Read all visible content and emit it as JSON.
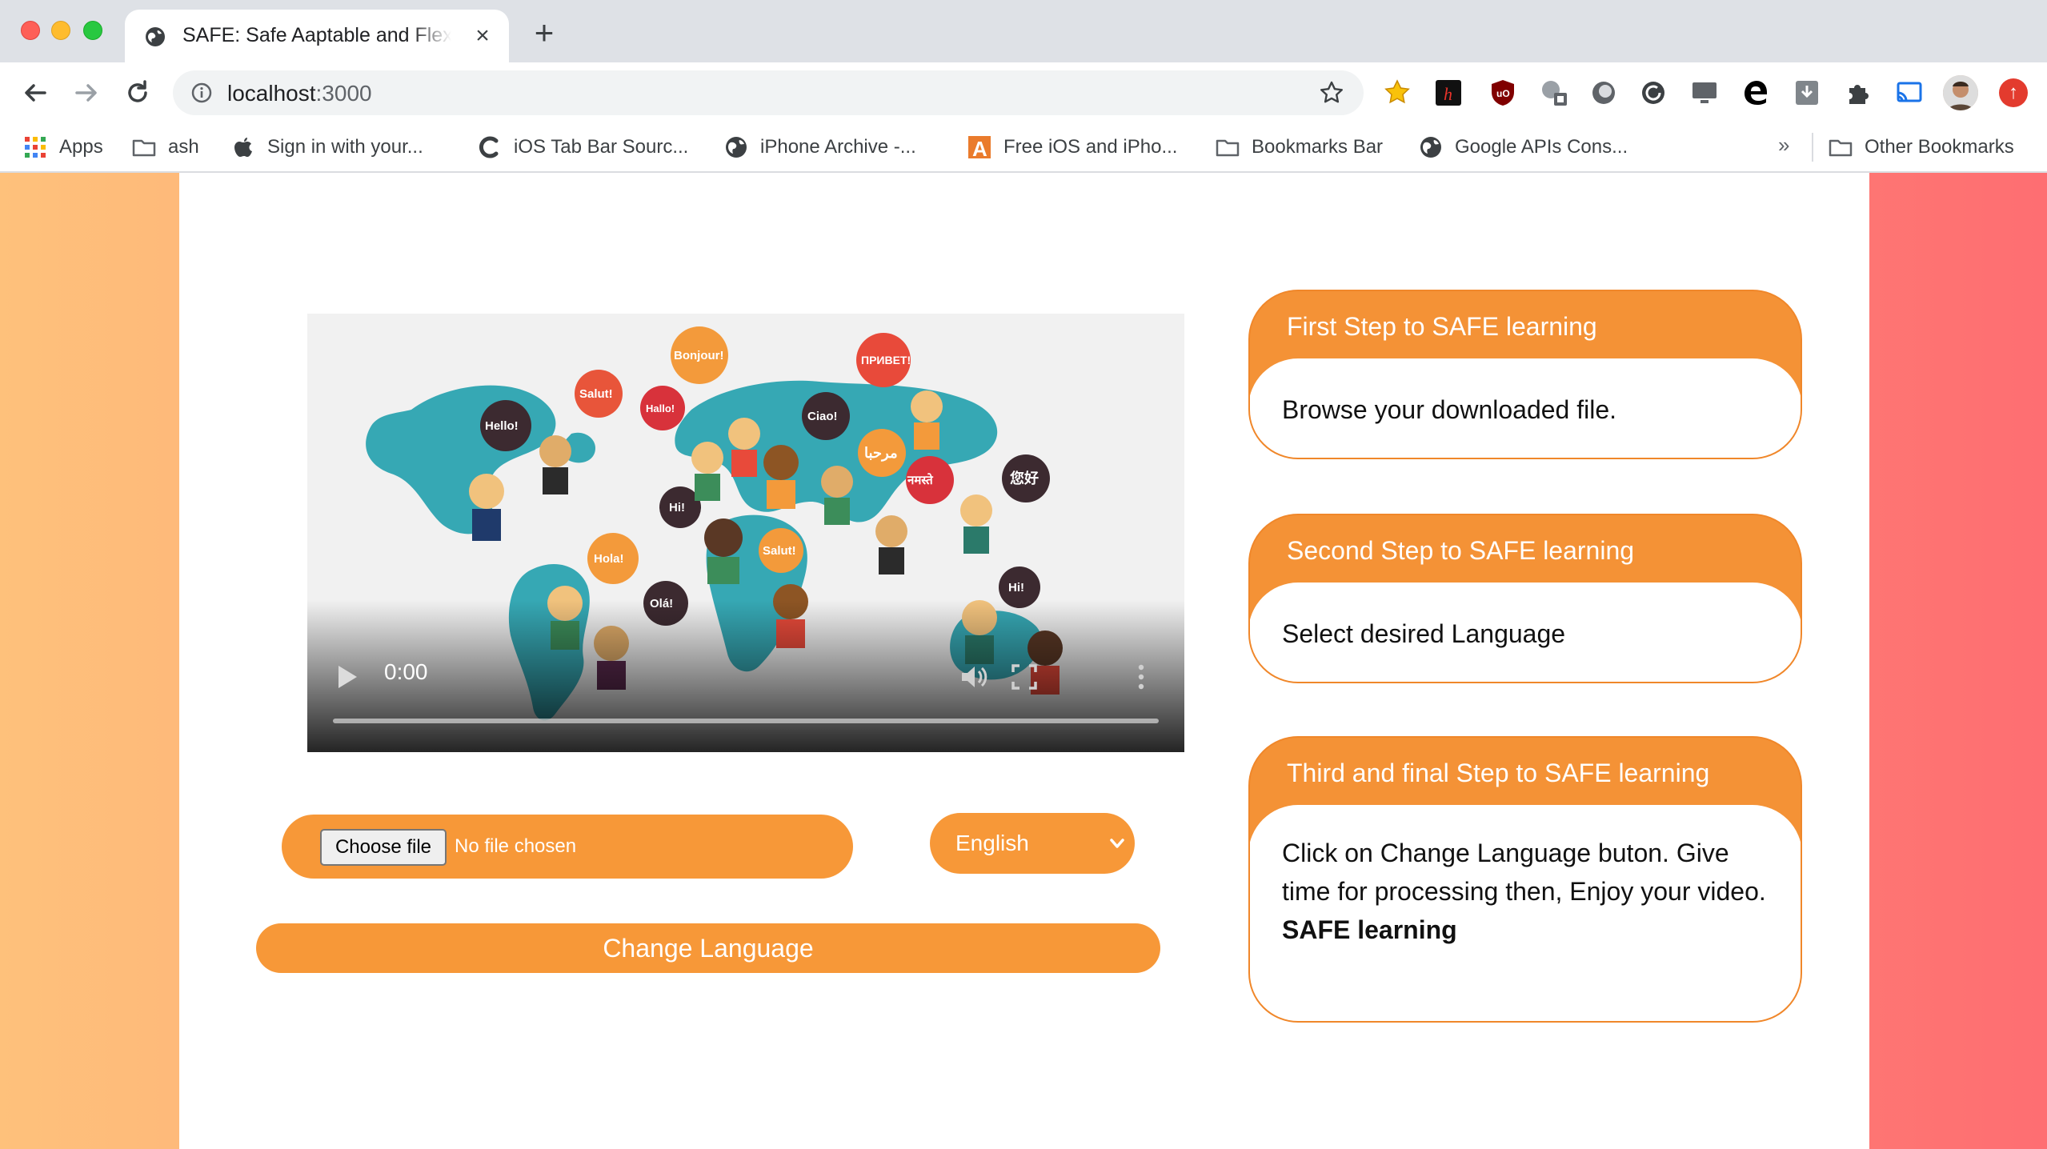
{
  "browser": {
    "tab_title": "SAFE: Safe Aaptable and Flexible",
    "url_host": "localhost",
    "url_port": ":3000",
    "bookmarks": [
      {
        "label": "Apps",
        "icon": "apps-grid-icon"
      },
      {
        "label": "ash",
        "icon": "folder-icon"
      },
      {
        "label": "Sign in with your...",
        "icon": "apple-icon"
      },
      {
        "label": "iOS Tab Bar Sourc...",
        "icon": "c-logo-icon"
      },
      {
        "label": "iPhone Archive -...",
        "icon": "globe-icon"
      },
      {
        "label": "Free iOS and iPho...",
        "icon": "a-logo-icon"
      },
      {
        "label": "Bookmarks Bar",
        "icon": "folder-icon"
      },
      {
        "label": "Google APIs Cons...",
        "icon": "globe-icon"
      }
    ],
    "bookmarks_more": "»",
    "other_bookmarks": "Other Bookmarks",
    "extension_icons": [
      "favorites-star-icon",
      "honey-extension-icon",
      "ublock-icon",
      "translate-extension-icon",
      "circle-extension-icon",
      "refresh-extension-icon",
      "screen-extension-icon",
      "edge-icon",
      "download-extension-icon",
      "puzzle-extensions-icon",
      "cast-icon"
    ]
  },
  "video": {
    "time": "0:00",
    "speech_bubbles": [
      "Bonjour!",
      "ПРИВЕТ!",
      "Hello!",
      "Salut!",
      "Hallo!",
      "Ciao!",
      "مرحبا",
      "नमस्ते",
      "您好",
      "Hi!",
      "Salut!",
      "Hola!",
      "Olá!",
      "Hi!"
    ]
  },
  "upload": {
    "choose_file_label": "Choose file",
    "no_file_text": "No file chosen"
  },
  "language": {
    "selected": "English"
  },
  "change_button_label": "Change Language",
  "steps": [
    {
      "title": "First Step to SAFE learning",
      "body": "Browse your downloaded file.",
      "strong": ""
    },
    {
      "title": "Second Step to SAFE learning",
      "body": "Select desired Language",
      "strong": ""
    },
    {
      "title": "Third and final Step to SAFE learning",
      "body": "Click on Change Language buton. Give time for processing then, Enjoy your video.",
      "strong": "SAFE learning"
    }
  ],
  "colors": {
    "accent_orange": "#f79838",
    "gradient_left": "#fec17b",
    "gradient_right": "#fe6e72",
    "map_teal": "#36a8b4"
  }
}
